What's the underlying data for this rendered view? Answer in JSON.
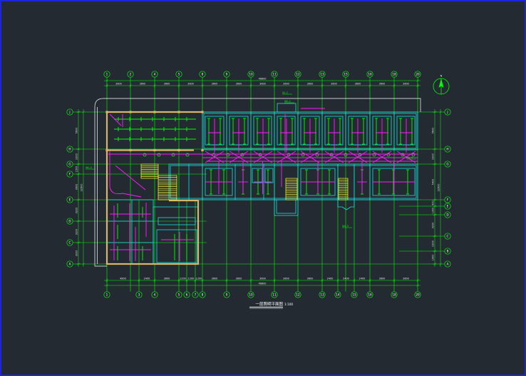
{
  "viewer": {
    "background": "#232a32",
    "border": "#1a26d8"
  },
  "colors": {
    "grid": "#00ff00",
    "wall": "#19e0e0",
    "outer_wall": "#d9b56c",
    "wiring": "#ff1cff",
    "stairs": "#ffff2e",
    "site": "#ffffff",
    "text": "#ffffff",
    "bubble_fill": "#232a32"
  },
  "axes": {
    "top": [
      "1",
      "2",
      "4",
      "5",
      "8",
      "9",
      "10",
      "11",
      "12",
      "13",
      "15",
      "16",
      "18",
      "20"
    ],
    "bottom": [
      "1",
      "3",
      "4",
      "5",
      "6",
      "7",
      "8",
      "9",
      "10",
      "11",
      "12",
      "13",
      "14",
      "15",
      "16",
      "18",
      "20"
    ],
    "left": [
      "J",
      "H",
      "G",
      "F",
      "E",
      "D",
      "C",
      "A"
    ],
    "right": [
      "J",
      "H",
      "G",
      "F",
      "E",
      "D",
      "C",
      "B",
      "A"
    ]
  },
  "dimensions": {
    "top_total": "46800",
    "top": [
      "3600",
      "3600",
      "3600",
      "3600",
      "3600",
      "3600",
      "3600",
      "3600",
      "3600",
      "3600",
      "3600",
      "3600",
      "3600"
    ],
    "bottom_total": "46800",
    "bottom": [
      "4800",
      "2400",
      "3600",
      "1200",
      "1200",
      "1200",
      "3600",
      "3600",
      "3600",
      "3600",
      "3600",
      "2400",
      "2400",
      "2400",
      "3600",
      "3600"
    ],
    "left_total": "22900",
    "left": [
      "5600",
      "2300",
      "1500",
      "3900",
      "3200",
      "3200",
      "3200"
    ],
    "right_total": "22900",
    "right": [
      "5600",
      "2300",
      "5400",
      "900",
      "1300",
      "3200",
      "2300",
      "1900"
    ]
  },
  "annotations": [
    "AL-1",
    "WL-1",
    "WL-2",
    "WL-3",
    "WL-4"
  ],
  "north_label": "N",
  "title": {
    "text": "一层照明平面图",
    "scale": "1:100"
  }
}
